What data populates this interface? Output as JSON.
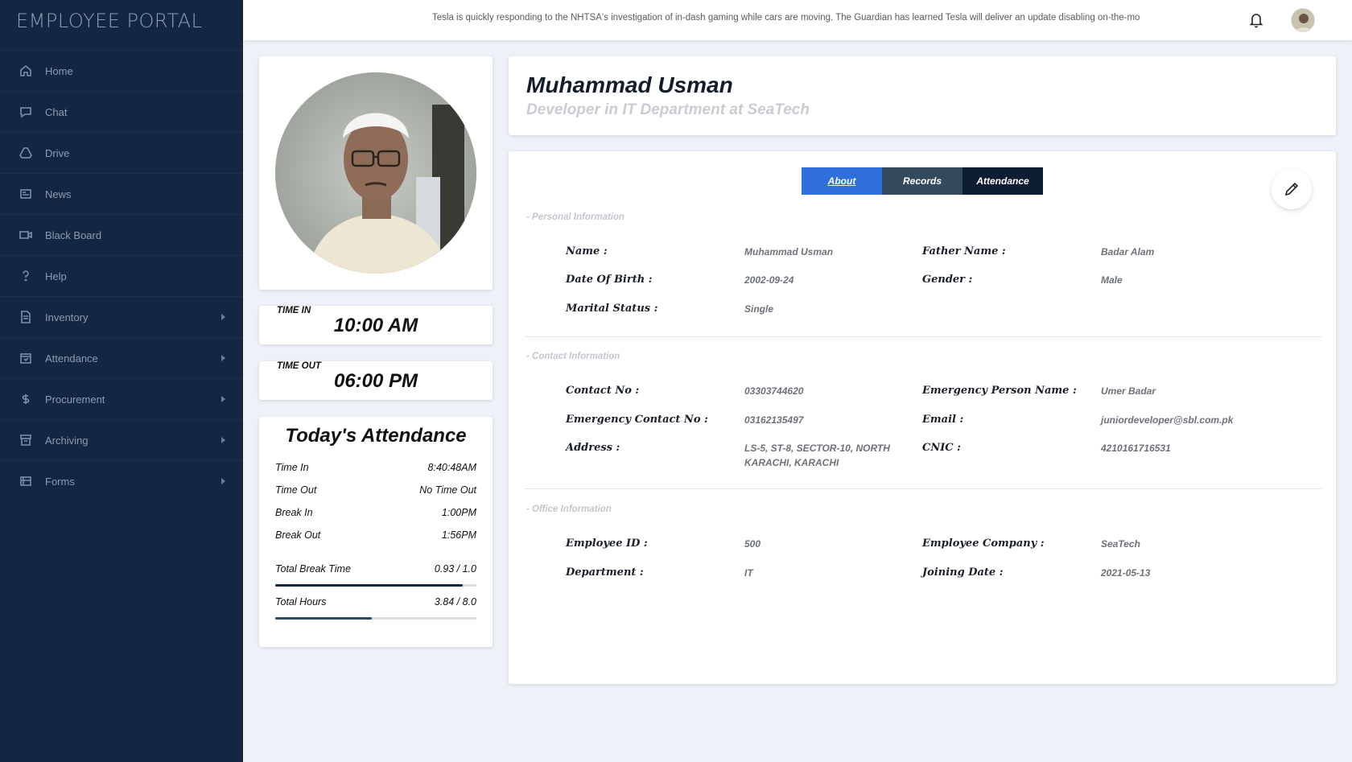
{
  "app": {
    "brand": "EMPLOYEE PORTAL"
  },
  "sidebar": {
    "items": [
      {
        "label": "Home",
        "icon": "home-icon",
        "has_submenu": false
      },
      {
        "label": "Chat",
        "icon": "chat-icon",
        "has_submenu": false
      },
      {
        "label": "Drive",
        "icon": "drive-icon",
        "has_submenu": false
      },
      {
        "label": "News",
        "icon": "news-icon",
        "has_submenu": false
      },
      {
        "label": "Black Board",
        "icon": "blackboard-icon",
        "has_submenu": false
      },
      {
        "label": "Help",
        "icon": "help-icon",
        "has_submenu": false
      },
      {
        "label": "Inventory",
        "icon": "inventory-icon",
        "has_submenu": true
      },
      {
        "label": "Attendance",
        "icon": "attendance-icon",
        "has_submenu": true
      },
      {
        "label": "Procurement",
        "icon": "dollar-icon",
        "has_submenu": true
      },
      {
        "label": "Archiving",
        "icon": "archive-icon",
        "has_submenu": true
      },
      {
        "label": "Forms",
        "icon": "forms-icon",
        "has_submenu": true
      }
    ]
  },
  "topbar": {
    "ticker": "Tesla is quickly responding to the NHTSA's investigation of in-dash gaming while cars are moving. The Guardian has learned Tesla will deliver an update disabling on-the-mo",
    "bell_icon": "bell-icon",
    "avatar_icon": "user-avatar"
  },
  "profile": {
    "time_in_label": "TIME IN",
    "time_in": "10:00 AM",
    "time_out_label": "TIME OUT",
    "time_out": "06:00 PM"
  },
  "attendance": {
    "title": "Today's Attendance",
    "rows": [
      {
        "label": "Time In",
        "value": "8:40:48AM"
      },
      {
        "label": "Time Out",
        "value": "No Time Out"
      },
      {
        "label": "Break In",
        "value": "1:00PM"
      },
      {
        "label": "Break Out",
        "value": "1:56PM"
      }
    ],
    "total_break": {
      "label": "Total Break Time",
      "value": "0.93 / 1.0",
      "fraction": 0.93,
      "color": "#132743"
    },
    "total_hours": {
      "label": "Total Hours",
      "value": "3.84 / 8.0",
      "fraction": 0.48,
      "color": "#2b4a5f"
    }
  },
  "header": {
    "name": "Muhammad Usman",
    "subtitle": "Developer in IT Department at SeaTech"
  },
  "tabs": [
    {
      "label": "About",
      "active": true
    },
    {
      "label": "Records",
      "active": false
    },
    {
      "label": "Attendance",
      "active": false
    }
  ],
  "edit_icon": "pencil-icon",
  "sections": {
    "personal": {
      "title": "- Personal Information",
      "name_label": "Name :",
      "name": "Muhammad Usman",
      "father_label": "Father Name :",
      "father": "Badar Alam",
      "dob_label": "Date Of Birth :",
      "dob": "2002-09-24",
      "gender_label": "Gender :",
      "gender": "Male",
      "marital_label": "Marital Status :",
      "marital": "Single"
    },
    "contact": {
      "title": "- Contact Information",
      "contact_label": "Contact No :",
      "contact": "03303744620",
      "emg_person_label": "Emergency Person Name :",
      "emg_person": "Umer Badar",
      "emg_contact_label": "Emergency Contact No :",
      "emg_contact": "03162135497",
      "email_label": "Email :",
      "email": "juniordeveloper@sbl.com.pk",
      "address_label": "Address :",
      "address_line1": "LS-5, ST-8, SECTOR-10, NORTH",
      "address_line2": "KARACHI, KARACHI",
      "cnic_label": "CNIC :",
      "cnic": "4210161716531"
    },
    "office": {
      "title": "- Office Information",
      "emp_id_label": "Employee ID :",
      "emp_id": "500",
      "company_label": "Employee Company :",
      "company": "SeaTech",
      "dept_label": "Department :",
      "dept": "IT",
      "joining_label": "Joining Date :",
      "joining": "2021-05-13"
    }
  }
}
